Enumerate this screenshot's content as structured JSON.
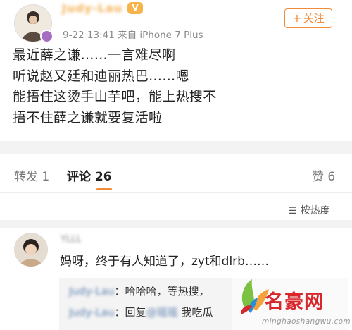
{
  "post": {
    "username": "Judy-Lau",
    "vip_badge": "V",
    "meta": "9-22 13:41  来自 iPhone 7 Plus",
    "follow_button": "关注",
    "follow_plus": "+",
    "body_lines": [
      "最近薛之谦……一言难尽啊",
      "听说赵又廷和迪丽热巴……嗯",
      "能捂住这烫手山芋吧，能上热搜不",
      "捂不住薛之谦就要复活啦"
    ]
  },
  "tabs": [
    {
      "label": "转发 1"
    },
    {
      "label": "评论 26"
    },
    {
      "label": "赞 6"
    }
  ],
  "sort": {
    "icon": "sort-icon",
    "label": "按热度"
  },
  "comment": {
    "author": "YLLL",
    "text": "妈呀，终于有人知道了，zyt和dlrb……",
    "replies": [
      {
        "author": "Judy-Lau",
        "text": "：哈哈哈，等热搜，"
      },
      {
        "author": "Judy-Lau",
        "prefix": "：回复",
        "mention": "@瑶瑶",
        "text": "我吃瓜"
      }
    ]
  },
  "watermark": {
    "title": "名豪网",
    "url": "minghaoshangwu.com"
  },
  "colors": {
    "accent": "#f08b3a",
    "username": "#f5b45a",
    "link": "#5b7fb0",
    "watermark": "#d8262b"
  }
}
